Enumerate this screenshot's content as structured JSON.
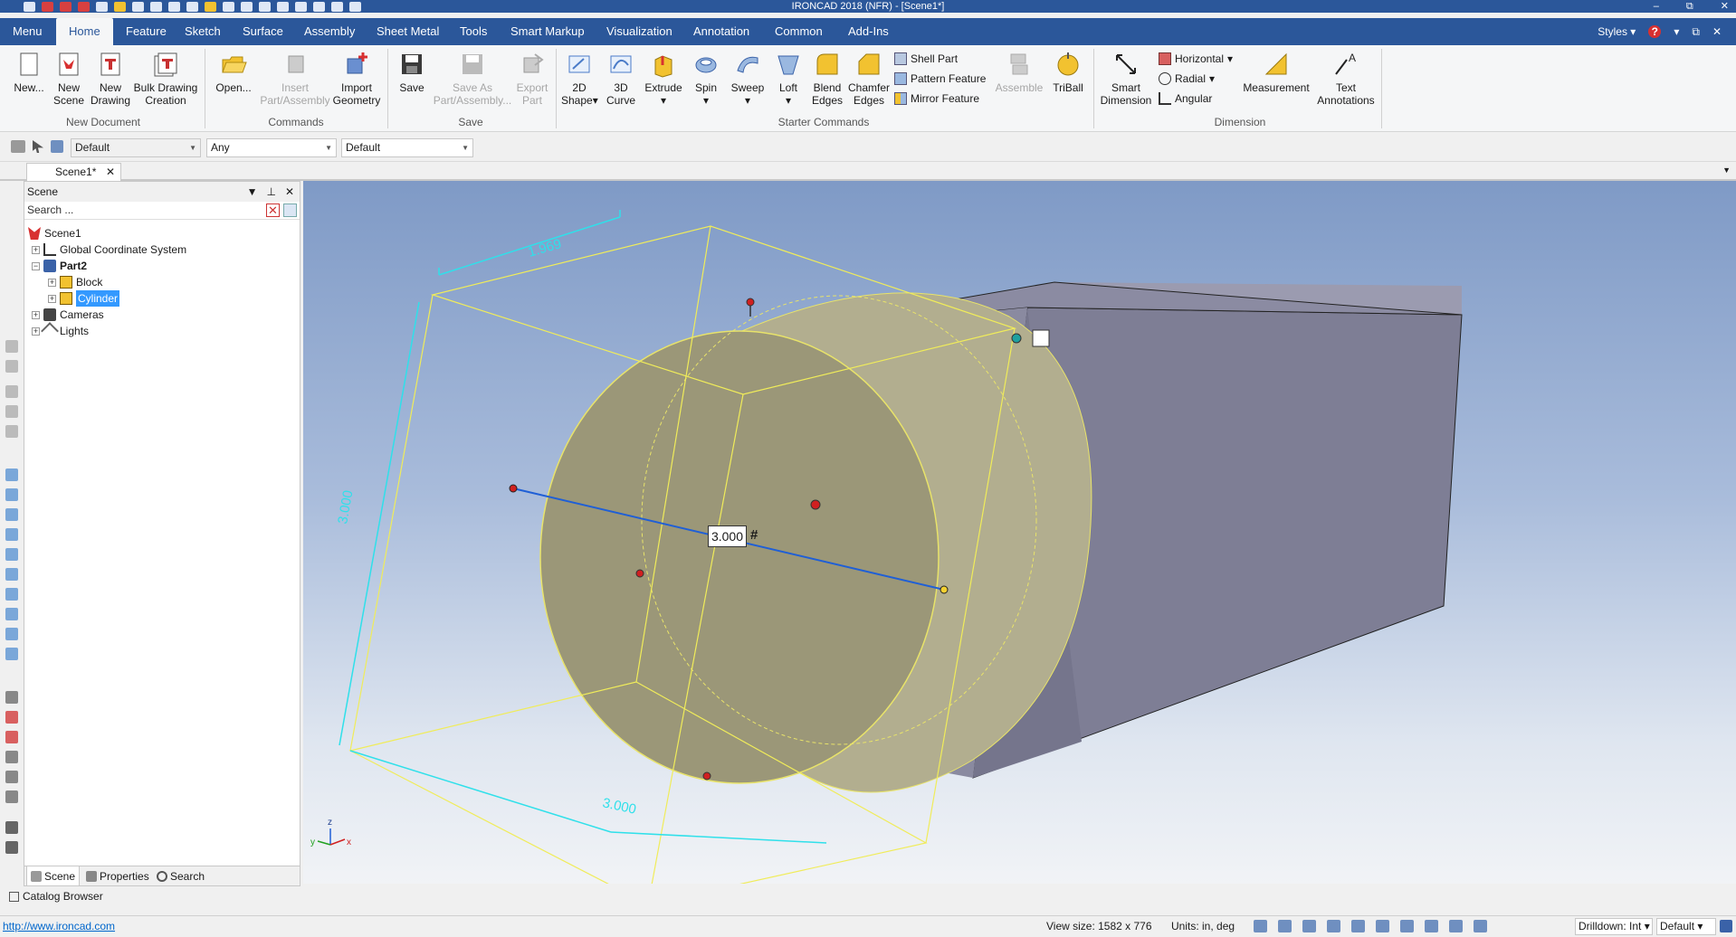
{
  "app": {
    "title": "IRONCAD 2018 (NFR) - [Scene1*]",
    "window_buttons": [
      "–",
      "⧉",
      "✕"
    ]
  },
  "tabs": {
    "items": [
      "Menu",
      "Home",
      "Feature",
      "Sketch",
      "Surface",
      "Assembly",
      "Sheet Metal",
      "Tools",
      "Smart Markup",
      "Visualization",
      "Annotation",
      "Common",
      "Add-Ins"
    ],
    "active": "Home",
    "styles_label": "Styles",
    "help_icon": "?"
  },
  "ribbon": {
    "new_document": {
      "label": "New Document",
      "new": "New...",
      "new_scene": [
        "New",
        "Scene"
      ],
      "new_drawing": [
        "New",
        "Drawing"
      ],
      "bulk": [
        "Bulk Drawing",
        "Creation"
      ]
    },
    "commands": {
      "label": "Commands",
      "open": "Open...",
      "insert": [
        "Insert",
        "Part/Assembly"
      ],
      "import": [
        "Import",
        "Geometry"
      ]
    },
    "save": {
      "label": "Save",
      "save": "Save",
      "save_as": [
        "Save As",
        "Part/Assembly..."
      ],
      "export": [
        "Export",
        "Part"
      ]
    },
    "starter": {
      "label": "Starter Commands",
      "shape2d": [
        "2D",
        "Shape"
      ],
      "curve3d": [
        "3D",
        "Curve"
      ],
      "extrude": "Extrude",
      "spin": "Spin",
      "sweep": "Sweep",
      "loft": "Loft",
      "blend": [
        "Blend",
        "Edges"
      ],
      "chamfer": [
        "Chamfer",
        "Edges"
      ],
      "shell": "Shell Part",
      "pattern": "Pattern Feature",
      "mirror": "Mirror Feature",
      "assemble": "Assemble",
      "triball": "TriBall"
    },
    "dimension": {
      "label": "Dimension",
      "smart": [
        "Smart",
        "Dimension"
      ],
      "horizontal": "Horizontal",
      "radial": "Radial",
      "angular": "Angular",
      "measurement": "Measurement",
      "text": [
        "Text",
        "Annotations"
      ]
    }
  },
  "toolbar2": {
    "combo1": "Default",
    "combo2": "Any",
    "combo3": "Default"
  },
  "doc_tab": {
    "name": "Scene1*",
    "close": "✕"
  },
  "scene_panel": {
    "title": "Scene",
    "search_placeholder": "Search ...",
    "tree": {
      "root": "Scene1",
      "gcs": "Global Coordinate System",
      "part": "Part2",
      "block": "Block",
      "cylinder": "Cylinder",
      "cameras": "Cameras",
      "lights": "Lights"
    },
    "tabs": [
      "Scene",
      "Properties",
      "Search"
    ]
  },
  "catalog_browser": "Catalog Browser",
  "viewport": {
    "dim_width": "1.969",
    "dim_height": "3.000",
    "dim_depth": "3.000",
    "dim_input": "3.000",
    "dim_hash": "#",
    "axis_z": "z",
    "axis_x": "x",
    "axis_y": "y"
  },
  "status": {
    "link": "http://www.ironcad.com",
    "view_size": "View size: 1582 x  776",
    "units": "Units: in, deg",
    "drilldown": "Drilldown: Int",
    "style": "Default"
  }
}
